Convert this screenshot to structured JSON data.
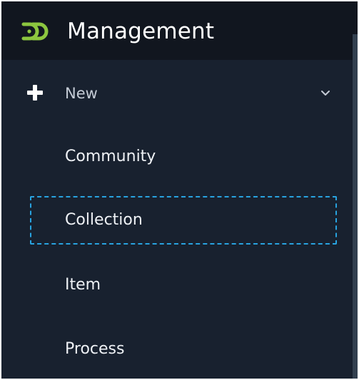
{
  "header": {
    "title": "Management",
    "logo_icon": "dspace-logo-icon",
    "logo_color": "#8cc63f"
  },
  "menu": {
    "new": {
      "label": "New",
      "icon": "plus-icon",
      "expand_icon": "chevron-down-icon",
      "expanded": true
    },
    "items": [
      {
        "label": "Community"
      },
      {
        "label": "Collection",
        "focused": true
      },
      {
        "label": "Item"
      },
      {
        "label": "Process"
      }
    ]
  },
  "colors": {
    "sidebar_background": "#18212f",
    "header_background": "#11161f",
    "focus_outline": "#28a3e0"
  }
}
